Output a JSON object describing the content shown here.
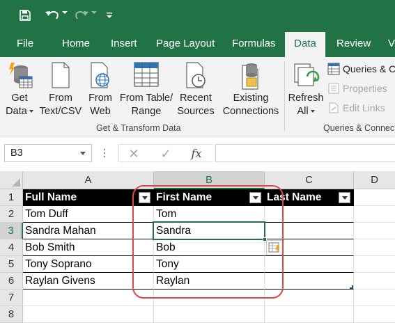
{
  "qat": {
    "icons": [
      "save-icon",
      "undo-icon",
      "redo-icon",
      "customize-qat-icon"
    ]
  },
  "tabs": [
    {
      "label": "File"
    },
    {
      "label": "Home"
    },
    {
      "label": "Insert"
    },
    {
      "label": "Page Layout"
    },
    {
      "label": "Formulas"
    },
    {
      "label": "Data",
      "active": true
    },
    {
      "label": "Review"
    },
    {
      "label": "V"
    }
  ],
  "ribbon": {
    "get_transform": {
      "group_label": "Get & Transform Data",
      "get_data": {
        "line1": "Get",
        "line2": "Data"
      },
      "from_text_csv": {
        "line1": "From",
        "line2": "Text/CSV"
      },
      "from_web": {
        "line1": "From",
        "line2": "Web"
      },
      "from_table_range": {
        "line1": "From Table/",
        "line2": "Range"
      },
      "recent_sources": {
        "line1": "Recent",
        "line2": "Sources"
      },
      "existing_connections": {
        "line1": "Existing",
        "line2": "Connections"
      }
    },
    "queries_connections": {
      "group_label": "Queries & Connec",
      "refresh_all": {
        "line1": "Refresh",
        "line2": "All"
      },
      "queries": "Queries & C",
      "properties": "Properties",
      "edit_links": "Edit Links"
    }
  },
  "formula_bar": {
    "name_box": "B3",
    "fx_label": "fx",
    "cancel_symbol": "✕",
    "enter_symbol": "✓",
    "value": ""
  },
  "grid": {
    "columns": [
      "A",
      "B",
      "C",
      "D"
    ],
    "selected_column": "B",
    "rows": [
      "1",
      "2",
      "3",
      "4",
      "5",
      "6",
      "7",
      "8"
    ],
    "selected_row": "3",
    "active_cell": "B3",
    "table": {
      "headers": [
        "Full Name",
        "First Name",
        "Last Name"
      ],
      "data": [
        [
          "Tom Duff",
          "Tom",
          ""
        ],
        [
          "Sandra Mahan",
          "Sandra",
          ""
        ],
        [
          "Bob Smith",
          "Bob",
          ""
        ],
        [
          "Tony Soprano",
          "Tony",
          ""
        ],
        [
          "Raylan Givens",
          "Raylan",
          ""
        ]
      ]
    }
  },
  "colors": {
    "excel_green": "#217346",
    "ribbon_bg": "#f3f3f3",
    "header_fill": "#000000",
    "annotation_red": "#e04848"
  }
}
